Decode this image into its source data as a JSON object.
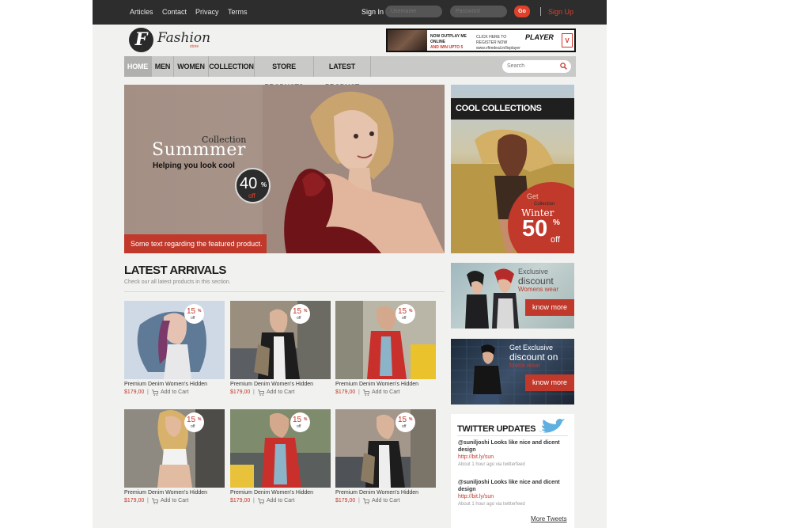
{
  "topbar": {
    "links": [
      "Articles",
      "Contact",
      "Privacy",
      "Terms"
    ],
    "signin_label": "Sign In",
    "username_placeholder": "Username",
    "password_placeholder": "Password",
    "go_label": "Go",
    "signup_label": "Sign Up"
  },
  "header": {
    "logo_letter": "F",
    "logo_name": "Fashion",
    "logo_sub": "store",
    "ad": {
      "line1": "NOW OUTPLAY ME ONLINE",
      "line2": "AND WIN UPTO 5 LACS*",
      "line3": "CLICK HERE TO REGISTER NOW",
      "line4": "www.vfiredeal.in/livplayer",
      "brand": "PLAYER",
      "logo": "V"
    }
  },
  "nav": {
    "items": [
      "HOME",
      "MEN",
      "WOMEN",
      "COLLECTION",
      "STORE PRODUCTS",
      "LATEST PRODUCT"
    ],
    "search_placeholder": "Search"
  },
  "hero": {
    "collection": "Collection",
    "title": "Summmer",
    "subtitle": "Helping you look cool",
    "badge_num": "40",
    "badge_pct": "%",
    "badge_off": "off",
    "caption": "Some text regarding the featured product."
  },
  "cool": {
    "heading": "COOL COLLECTIONS",
    "get": "Get",
    "collection": "Collection",
    "winter": "Winter",
    "discount": "50",
    "pct": "%",
    "off": "off"
  },
  "latest": {
    "title": "LATEST ARRIVALS",
    "subtitle": "Check our all latest products in this section.",
    "products": [
      {
        "name": "Premium Denim Women's Hidden",
        "price": "$179,00",
        "cart": "Add to Cart",
        "badge": "15",
        "pct": "%",
        "off": "off"
      },
      {
        "name": "Premium Denim Women's Hidden",
        "price": "$179,00",
        "cart": "Add to Cart",
        "badge": "15",
        "pct": "%",
        "off": "off"
      },
      {
        "name": "Premium Denim Women's Hidden",
        "price": "$179,00",
        "cart": "Add to Cart",
        "badge": "15",
        "pct": "%",
        "off": "off"
      },
      {
        "name": "Premium Denim Women's Hidden",
        "price": "$179,00",
        "cart": "Add to Cart",
        "badge": "15",
        "pct": "%",
        "off": "off"
      },
      {
        "name": "Premium Denim Women's Hidden",
        "price": "$179,00",
        "cart": "Add to Cart",
        "badge": "15",
        "pct": "%",
        "off": "off"
      },
      {
        "name": "Premium Denim Women's Hidden",
        "price": "$179,00",
        "cart": "Add to Cart",
        "badge": "15",
        "pct": "%",
        "off": "off"
      }
    ]
  },
  "promos": [
    {
      "line1": "Exclusive",
      "line2": "discount",
      "line3": "Womens wear",
      "button": "know more"
    },
    {
      "line1": "Get Exclusive",
      "line2": "discount on",
      "line3": "Mens wear",
      "button": "know more"
    }
  ],
  "twitter": {
    "title": "TWITTER UPDATES",
    "tweets": [
      {
        "text": "@suniljoshi Looks like nice and dicent design",
        "link": "http://bit.ly/sun",
        "meta": "About 1 hour ago via twitterfeed"
      },
      {
        "text": "@suniljoshi Looks like nice and dicent design",
        "link": "http://bit.ly/sun",
        "meta": "About 1 hour ago via twitterfeed"
      }
    ],
    "more": "More Tweets"
  },
  "colors": {
    "accent": "#c0392b",
    "topbar": "#2d2d2d",
    "nav": "#c9c9c7",
    "page": "#f1f1ef"
  }
}
